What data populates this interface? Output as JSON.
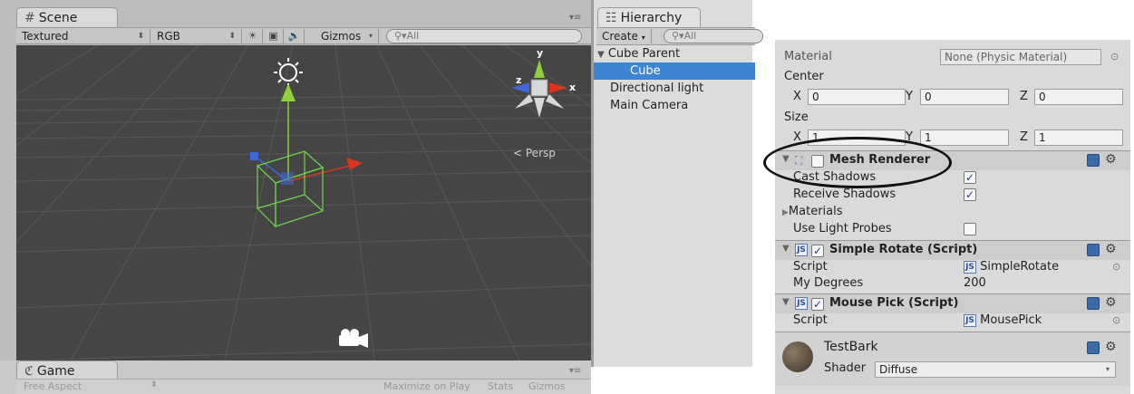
{
  "scene": {
    "tab_label": "Scene",
    "render_mode": "Textured",
    "color_mode": "RGB",
    "gizmos_label": "Gizmos",
    "search_placeholder": "All",
    "persp_label": "Persp",
    "axis_x": "x",
    "axis_y": "y",
    "axis_z": "z"
  },
  "game": {
    "tab_label": "Game",
    "aspect": "Free Aspect",
    "maximize_label": "Maximize on Play",
    "stats_label": "Stats",
    "gizmos_label": "Gizmos"
  },
  "hierarchy": {
    "tab_label": "Hierarchy",
    "create_label": "Create",
    "search_placeholder": "All",
    "items": [
      {
        "label": "Cube Parent"
      },
      {
        "label": "Cube"
      },
      {
        "label": "Directional light"
      },
      {
        "label": "Main Camera"
      }
    ]
  },
  "inspector": {
    "material_label": "Material",
    "material_value": "None (Physic Material)",
    "center_label": "Center",
    "center": {
      "x_label": "X",
      "x": "0",
      "y_label": "Y",
      "y": "0",
      "z_label": "Z",
      "z": "0"
    },
    "size_label": "Size",
    "size": {
      "x_label": "X",
      "x": "1",
      "y_label": "Y",
      "y": "1",
      "z_label": "Z",
      "z": "1"
    },
    "mesh_renderer": {
      "title": "Mesh Renderer",
      "cast_shadows": "Cast Shadows",
      "receive_shadows": "Receive Shadows",
      "materials": "Materials",
      "use_light_probes": "Use Light Probes"
    },
    "simple_rotate": {
      "title": "Simple Rotate  (Script)",
      "script_label": "Script",
      "script_value": "SimpleRotate",
      "degrees_label": "My Degrees",
      "degrees_value": "200"
    },
    "mouse_pick": {
      "title": "Mouse Pick (Script)",
      "script_label": "Script",
      "script_value": "MousePick"
    },
    "material_asset": {
      "name": "TestBark",
      "shader_label": "Shader",
      "shader_value": "Diffuse"
    },
    "js_icon": "JS"
  },
  "colors": {
    "viewport_bg": "#454545",
    "selection_blue": "#3d86d6",
    "bounds_green": "#6fd64a",
    "axis_red": "#d9341c",
    "axis_green": "#8fd13a",
    "axis_blue": "#3f67d8"
  }
}
